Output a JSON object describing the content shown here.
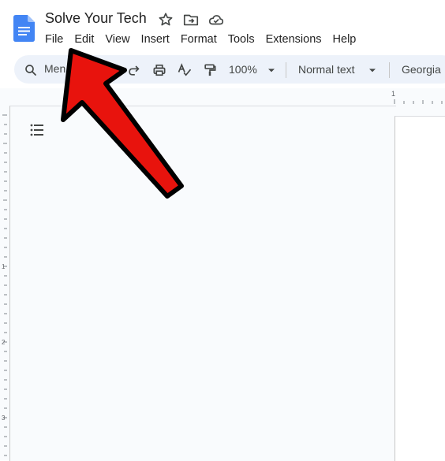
{
  "document": {
    "title": "Solve Your Tech"
  },
  "menu": [
    {
      "label": "File"
    },
    {
      "label": "Edit"
    },
    {
      "label": "View"
    },
    {
      "label": "Insert"
    },
    {
      "label": "Format"
    },
    {
      "label": "Tools"
    },
    {
      "label": "Extensions"
    },
    {
      "label": "Help"
    }
  ],
  "toolbar": {
    "search_label": "Men",
    "zoom": "100%",
    "paragraph_style": "Normal text",
    "font": "Georgia"
  },
  "ruler": {
    "top_mark": "1",
    "left_marks": [
      "1",
      "2",
      "3"
    ]
  },
  "colors": {
    "accent": "#4285f4",
    "toolbar_bg": "#edf2fa",
    "annotation_arrow": "#e8130d"
  },
  "icons": {
    "doc": "google-docs-icon",
    "star": "star-icon",
    "move": "move-to-folder-icon",
    "cloud": "cloud-saved-icon",
    "search": "search-icon",
    "redo": "redo-icon",
    "print": "print-icon",
    "spellcheck": "spellcheck-icon",
    "paint": "paint-format-icon",
    "outline": "document-outline-icon"
  }
}
